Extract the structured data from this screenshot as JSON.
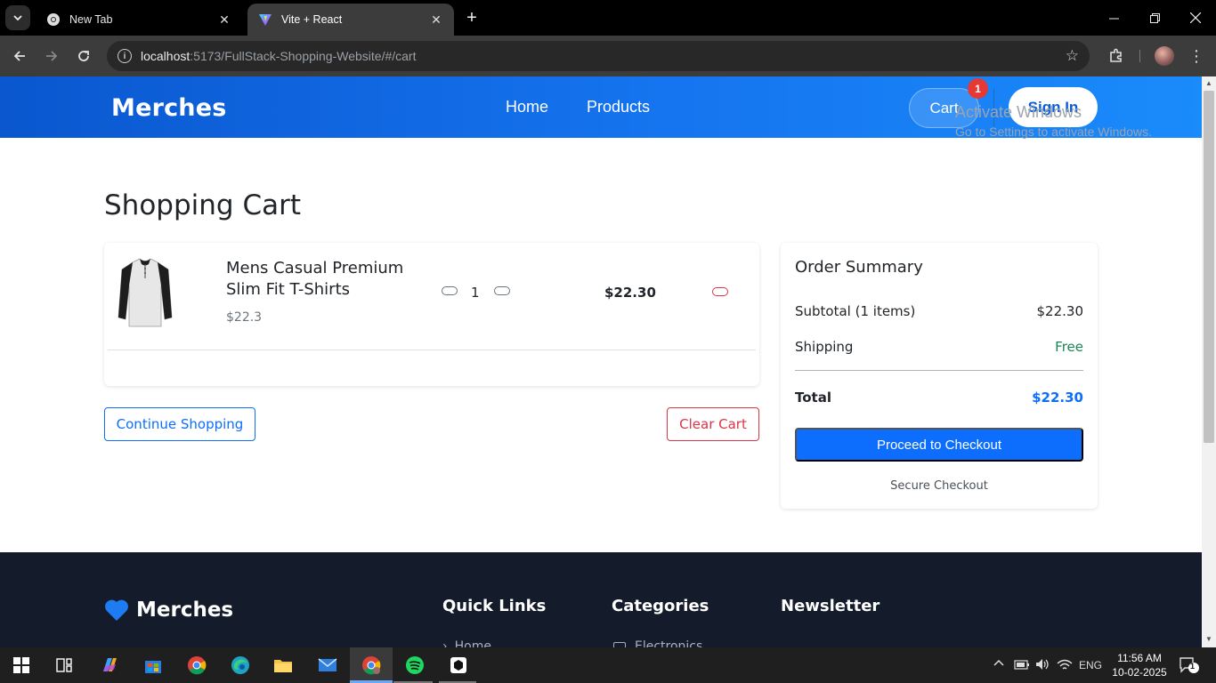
{
  "browser": {
    "tabs": [
      {
        "title": "New Tab",
        "active": false
      },
      {
        "title": "Vite + React",
        "active": true
      }
    ],
    "url_host": "localhost",
    "url_path": ":5173/FullStack-Shopping-Website/#/cart"
  },
  "header": {
    "logo": "Merches",
    "nav": [
      "Home",
      "Products"
    ],
    "cart_label": "Cart",
    "cart_count": "1",
    "signin_label": "Sign In"
  },
  "page": {
    "title": "Shopping Cart"
  },
  "cart": {
    "items": [
      {
        "name": "Mens Casual Premium Slim Fit T-Shirts",
        "price": "$22.3",
        "quantity": "1",
        "total": "$22.30"
      }
    ],
    "continue_label": "Continue Shopping",
    "clear_label": "Clear Cart"
  },
  "summary": {
    "title": "Order Summary",
    "subtotal_label": "Subtotal (1 items)",
    "subtotal_value": "$22.30",
    "shipping_label": "Shipping",
    "shipping_value": "Free",
    "total_label": "Total",
    "total_value": "$22.30",
    "checkout_label": "Proceed to Checkout",
    "secure_label": "Secure Checkout"
  },
  "footer": {
    "logo": "Merches",
    "quick_links_title": "Quick Links",
    "categories_title": "Categories",
    "newsletter_title": "Newsletter",
    "quick_link_first": "Home",
    "category_first": "Electronics"
  },
  "watermark": {
    "line1": "Activate Windows",
    "line2": "Go to Settings to activate Windows."
  },
  "taskbar": {
    "language": "ENG",
    "time": "11:56 AM",
    "date": "10-02-2025",
    "notifications": "1"
  },
  "colors": {
    "primary": "#0d6efd",
    "danger": "#dc3545",
    "success": "#198754",
    "header_gradient_start": "#0a57cf",
    "header_gradient_end": "#1a8bfb",
    "footer_bg": "#141c2b"
  }
}
